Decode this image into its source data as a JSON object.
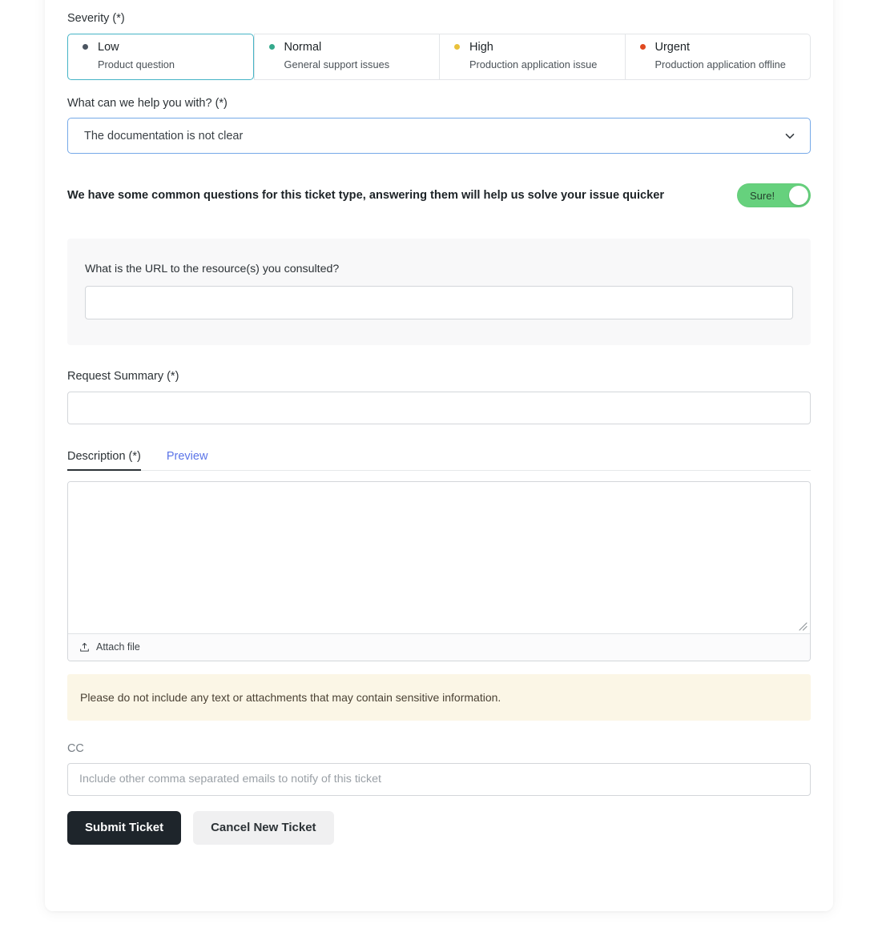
{
  "severity": {
    "label": "Severity (*)",
    "options": [
      {
        "title": "Low",
        "subtitle": "Product question",
        "dot_color": "#4b5561",
        "selected": true
      },
      {
        "title": "Normal",
        "subtitle": "General support issues",
        "dot_color": "#34a98c",
        "selected": false
      },
      {
        "title": "High",
        "subtitle": "Production application issue",
        "dot_color": "#e9c13b",
        "selected": false
      },
      {
        "title": "Urgent",
        "subtitle": "Production application offline",
        "dot_color": "#e0491f",
        "selected": false
      }
    ],
    "selected_border_color": "#45b4c6"
  },
  "help_select": {
    "label": "What can we help you with? (*)",
    "value": "The documentation is not clear",
    "icon": "chevron-down-icon",
    "focus_border_color": "#76a9e8"
  },
  "common_questions": {
    "text": "We have some common questions for this ticket type, answering them will help us solve your issue quicker",
    "toggle_label": "Sure!",
    "toggle_on": true,
    "toggle_color": "#66d17d"
  },
  "question_panel": {
    "label": "What is the URL to the resource(s) you consulted?",
    "value": "",
    "placeholder": ""
  },
  "request_summary": {
    "label": "Request Summary (*)",
    "value": "",
    "placeholder": ""
  },
  "description": {
    "tabs": [
      {
        "label": "Description (*)",
        "active": true
      },
      {
        "label": "Preview",
        "active": false
      }
    ],
    "value": "",
    "placeholder": "",
    "attach_label": "Attach file",
    "attach_icon": "upload-icon",
    "resize_icon": "resize-grip-icon"
  },
  "warning": {
    "text": "Please do not include any text or attachments that may contain sensitive information.",
    "bg_color": "#fbf6e6"
  },
  "cc": {
    "label": "CC",
    "value": "",
    "placeholder": "Include other comma separated emails to notify of this ticket"
  },
  "actions": {
    "submit_label": "Submit Ticket",
    "cancel_label": "Cancel New Ticket",
    "submit_bg": "#1e252b",
    "cancel_bg": "#f0f0f1"
  }
}
